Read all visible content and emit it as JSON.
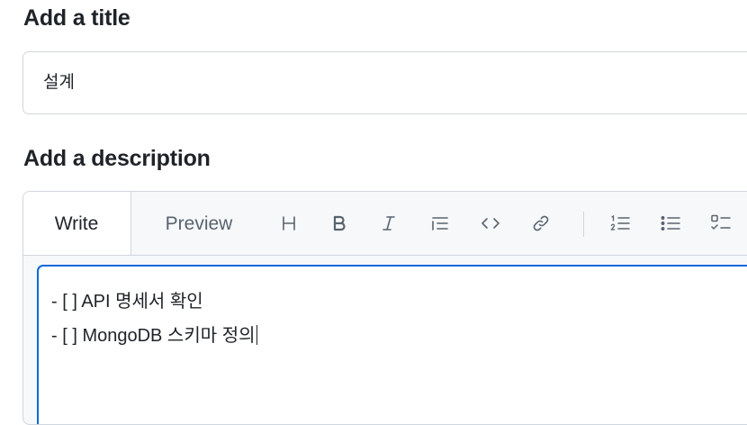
{
  "title_section": {
    "heading": "Add a title",
    "input_value": "설계"
  },
  "description_section": {
    "heading": "Add a description",
    "tabs": [
      {
        "label": "Write",
        "active": true
      },
      {
        "label": "Preview",
        "active": false
      }
    ],
    "toolbar_icons": [
      "heading-icon",
      "bold-icon",
      "italic-icon",
      "quote-icon",
      "code-icon",
      "link-icon",
      "ordered-list-icon",
      "unordered-list-icon",
      "task-list-icon"
    ],
    "body_lines": [
      "- [ ] API 명세서 확인",
      "- [ ] MongoDB 스키마 정의"
    ]
  },
  "colors": {
    "accent_border": "#0969da",
    "panel_bg": "#f6f8fa",
    "border": "#d0d7de",
    "muted_text": "#59636e"
  }
}
